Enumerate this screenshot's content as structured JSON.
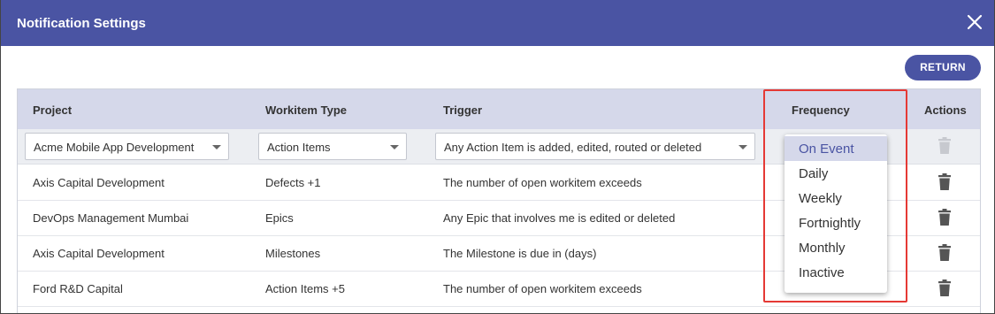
{
  "dialog": {
    "title": "Notification Settings",
    "return_label": "RETURN"
  },
  "table": {
    "headers": {
      "project": "Project",
      "workitem_type": "Workitem Type",
      "trigger": "Trigger",
      "frequency": "Frequency",
      "actions": "Actions"
    },
    "filters": {
      "project": "Acme Mobile App Development",
      "workitem_type": "Action Items",
      "trigger": "Any Action Item is added, edited, routed or deleted"
    },
    "rows": [
      {
        "project": "Axis Capital Development",
        "workitem_type": "Defects +1",
        "trigger": "The number of open workitem exceeds"
      },
      {
        "project": "DevOps Management Mumbai",
        "workitem_type": "Epics",
        "trigger": "Any Epic that involves me is edited or deleted"
      },
      {
        "project": "Axis Capital Development",
        "workitem_type": "Milestones",
        "trigger": "The Milestone is due in (days)"
      },
      {
        "project": "Ford R&D Capital",
        "workitem_type": "Action Items +5",
        "trigger": "The number of open workitem exceeds"
      }
    ]
  },
  "frequency_dropdown": {
    "selected": "On Event",
    "options": [
      "On Event",
      "Daily",
      "Weekly",
      "Fortnightly",
      "Monthly",
      "Inactive"
    ]
  },
  "colors": {
    "brand": "#4a54a3",
    "header_bg": "#d5d8ea",
    "highlight": "#e53935"
  },
  "icons": {
    "close": "close-icon",
    "trash": "trash-icon",
    "caret": "chevron-down-icon"
  }
}
